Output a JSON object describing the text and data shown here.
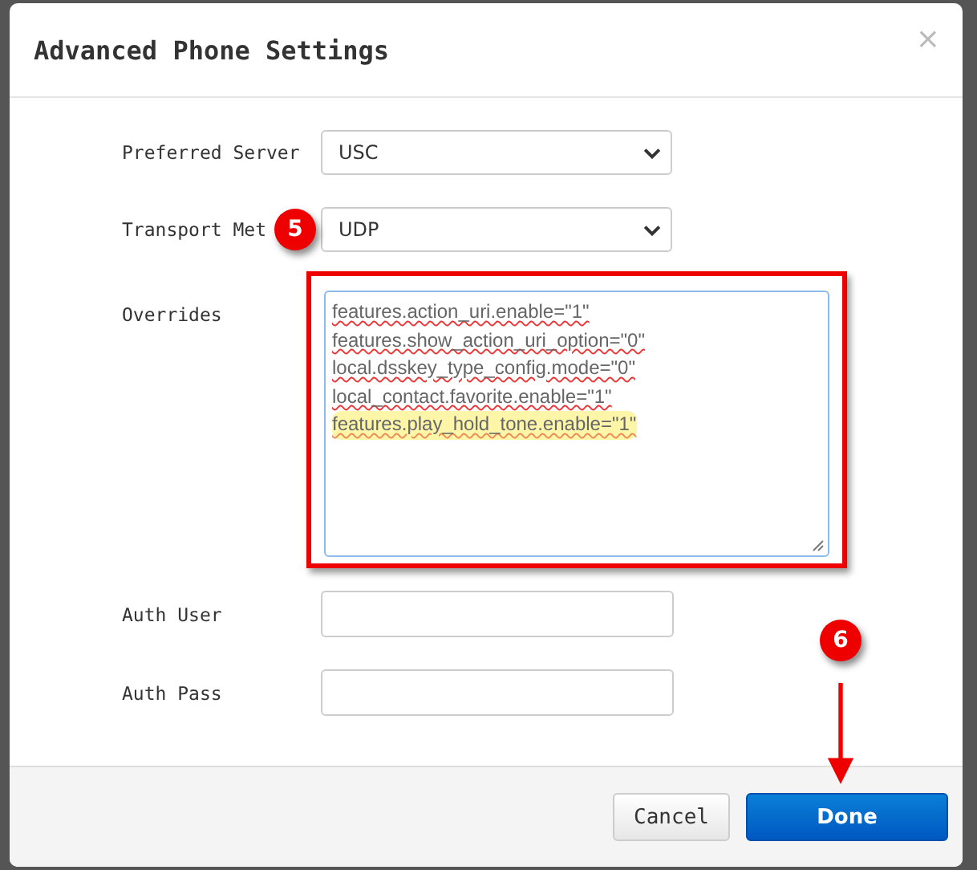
{
  "dialog": {
    "title": "Advanced Phone Settings",
    "close": "×"
  },
  "fields": [
    {
      "kind": "select",
      "label": "Preferred Server",
      "value": "USC"
    },
    {
      "kind": "select",
      "label": "Transport Met",
      "value": "UDP",
      "badge": "5"
    },
    {
      "kind": "textarea",
      "label": "Overrides",
      "lines": [
        {
          "text": "features.action_uri.enable=\"1\"",
          "highlighted": false
        },
        {
          "text": "features.show_action_uri_option=\"0\"",
          "highlighted": false
        },
        {
          "text": "local.dsskey_type_config.mode=\"0\"",
          "highlighted": false
        },
        {
          "text": "local_contact.favorite.enable=\"1\"",
          "highlighted": false
        },
        {
          "text": "features.play_hold_tone.enable=\"1\"",
          "highlighted": true
        }
      ]
    },
    {
      "kind": "input",
      "label": "Auth User"
    },
    {
      "kind": "input",
      "label": "Auth Pass"
    }
  ],
  "buttons": [
    {
      "label": "Cancel",
      "primary": false
    },
    {
      "label": "Done",
      "primary": true,
      "badge": "6"
    }
  ]
}
